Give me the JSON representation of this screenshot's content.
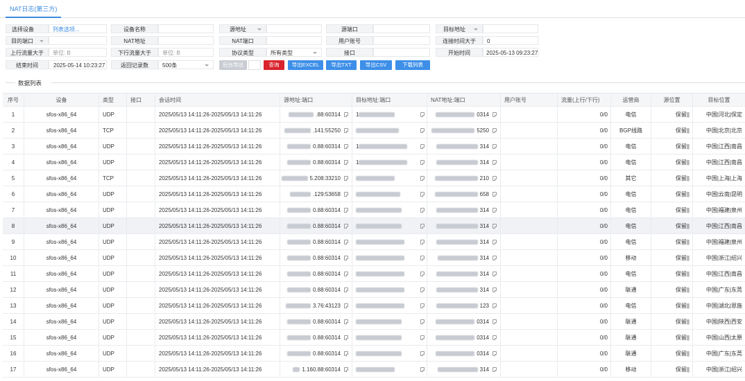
{
  "tab": "NAT日志(第三方)",
  "filters": {
    "device_label": "选择设备",
    "device_link": "列表选项...",
    "device_name_label": "设备名称",
    "src_addr_label": "源地址",
    "src_port_label": "源端口",
    "dst_addr_label": "目标地址",
    "dst_port_label": "目的端口",
    "nat_addr_label": "NAT地址",
    "nat_port_label": "NAT端口",
    "user_label": "用户账号",
    "conn_time_label": "连接时间大于",
    "conn_time_value": "0",
    "up_label": "上行流量大于",
    "up_placeholder": "单位: B",
    "down_label": "下行流量大于",
    "down_placeholder": "单位: B",
    "proto_label": "协议类型",
    "proto_value": "所有类型",
    "iface_label": "接口",
    "start_label": "开始时间",
    "start_value": "2025-05-13 09:23:27",
    "end_label": "结束时间",
    "end_value": "2025-05-14 10:23:27",
    "limit_label": "返回记录数",
    "limit_value": "500条"
  },
  "buttons": {
    "bg_export": "后台导出",
    "query": "查询",
    "excel": "导出EXCEL",
    "txt": "导出TXT",
    "csv": "导出CSV",
    "download": "下载列表"
  },
  "section_title": "数据列表",
  "columns": [
    "序号",
    "设备",
    "类型",
    "接口",
    "会话时间",
    "源地址:端口",
    "目标地址:端口",
    "NAT地址:端口",
    "用户账号",
    "流量(上行/下行)",
    "运营商",
    "源位置",
    "目标位置"
  ],
  "rows": [
    {
      "n": "1",
      "dev": "sfos-x86_64",
      "type": "UDP",
      "iface": "",
      "time": "2025/05/13 14:11:26-2025/05/13 14:11:26",
      "src": ".88:60314",
      "dst": "1",
      "nat": "0314",
      "user": "",
      "flow": "0/0",
      "isp": "电信",
      "srcloc": "保留||",
      "dstloc": "中国|河北|保定"
    },
    {
      "n": "2",
      "dev": "sfos-x86_64",
      "type": "TCP",
      "iface": "",
      "time": "2025/05/13 14:11:26-2025/05/13 14:11:26",
      "src": ".141:55250",
      "dst": "",
      "nat": "5250",
      "user": "",
      "flow": "0/0",
      "isp": "BGP线路",
      "srcloc": "保留||",
      "dstloc": "中国|北京|北京"
    },
    {
      "n": "3",
      "dev": "sfos-x86_64",
      "type": "UDP",
      "iface": "",
      "time": "2025/05/13 14:11:26-2025/05/13 14:11:26",
      "src": "0.88:60314",
      "dst": "1",
      "nat": "314",
      "user": "",
      "flow": "0/0",
      "isp": "电信",
      "srcloc": "保留||",
      "dstloc": "中国|江西|南昌"
    },
    {
      "n": "4",
      "dev": "sfos-x86_64",
      "type": "UDP",
      "iface": "",
      "time": "2025/05/13 14:11:26-2025/05/13 14:11:26",
      "src": "0.88:60314",
      "dst": "1",
      "nat": "314",
      "user": "",
      "flow": "0/0",
      "isp": "电信",
      "srcloc": "保留||",
      "dstloc": "中国|江西|南昌"
    },
    {
      "n": "5",
      "dev": "sfos-x86_64",
      "type": "TCP",
      "iface": "",
      "time": "2025/05/13 14:11:26-2025/05/13 14:11:26",
      "src": "5.208:33210",
      "dst": "",
      "nat": "210",
      "user": "",
      "flow": "0/0",
      "isp": "其它",
      "srcloc": "保留||",
      "dstloc": "中国|上海|上海"
    },
    {
      "n": "6",
      "dev": "sfos-x86_64",
      "type": "UDP",
      "iface": "",
      "time": "2025/05/13 14:11:26-2025/05/13 14:11:26",
      "src": ".129:53658",
      "dst": "",
      "nat": "658",
      "user": "",
      "flow": "0/0",
      "isp": "电信",
      "srcloc": "保留||",
      "dstloc": "中国|云南|昆明"
    },
    {
      "n": "7",
      "dev": "sfos-x86_64",
      "type": "UDP",
      "iface": "",
      "time": "2025/05/13 14:11:26-2025/05/13 14:11:26",
      "src": "0.88:60314",
      "dst": "",
      "nat": "314",
      "user": "",
      "flow": "0/0",
      "isp": "电信",
      "srcloc": "保留||",
      "dstloc": "中国|福建|泉州"
    },
    {
      "n": "8",
      "dev": "sfos-x86_64",
      "type": "UDP",
      "iface": "",
      "time": "2025/05/13 14:11:26-2025/05/13 14:11:26",
      "src": "0.88:60314",
      "dst": "",
      "nat": "314",
      "user": "",
      "flow": "0/0",
      "isp": "电信",
      "srcloc": "保留||",
      "dstloc": "中国|江西|南昌"
    },
    {
      "n": "9",
      "dev": "sfos-x86_64",
      "type": "UDP",
      "iface": "",
      "time": "2025/05/13 14:11:26-2025/05/13 14:11:26",
      "src": "0.88:60314",
      "dst": "",
      "nat": "314",
      "user": "",
      "flow": "0/0",
      "isp": "电信",
      "srcloc": "保留||",
      "dstloc": "中国|福建|泉州"
    },
    {
      "n": "10",
      "dev": "sfos-x86_64",
      "type": "UDP",
      "iface": "",
      "time": "2025/05/13 14:11:26-2025/05/13 14:11:26",
      "src": "0.88:60314",
      "dst": "",
      "nat": "314",
      "user": "",
      "flow": "0/0",
      "isp": "移动",
      "srcloc": "保留||",
      "dstloc": "中国|浙江|绍兴"
    },
    {
      "n": "11",
      "dev": "sfos-x86_64",
      "type": "UDP",
      "iface": "",
      "time": "2025/05/13 14:11:26-2025/05/13 14:11:26",
      "src": "0.88:60314",
      "dst": "",
      "nat": "314",
      "user": "",
      "flow": "0/0",
      "isp": "电信",
      "srcloc": "保留||",
      "dstloc": "中国|江西|南昌"
    },
    {
      "n": "12",
      "dev": "sfos-x86_64",
      "type": "UDP",
      "iface": "",
      "time": "2025/05/13 14:11:26-2025/05/13 14:11:26",
      "src": "0.88:60314",
      "dst": "",
      "nat": "314",
      "user": "",
      "flow": "0/0",
      "isp": "联通",
      "srcloc": "保留||",
      "dstloc": "中国|广东|东莞"
    },
    {
      "n": "13",
      "dev": "sfos-x86_64",
      "type": "UDP",
      "iface": "",
      "time": "2025/05/13 14:11:26-2025/05/13 14:11:26",
      "src": "3.76:43123",
      "dst": "",
      "nat": "123",
      "user": "",
      "flow": "0/0",
      "isp": "电信",
      "srcloc": "保留||",
      "dstloc": "中国|湖北|恩施"
    },
    {
      "n": "14",
      "dev": "sfos-x86_64",
      "type": "UDP",
      "iface": "",
      "time": "2025/05/13 14:11:26-2025/05/13 14:11:26",
      "src": "0.88:60314",
      "dst": "",
      "nat": "0314",
      "user": "",
      "flow": "0/0",
      "isp": "联通",
      "srcloc": "保留||",
      "dstloc": "中国|陕西|西安"
    },
    {
      "n": "15",
      "dev": "sfos-x86_64",
      "type": "UDP",
      "iface": "",
      "time": "2025/05/13 14:11:26-2025/05/13 14:11:26",
      "src": "0.88:60314",
      "dst": "",
      "nat": "0314",
      "user": "",
      "flow": "0/0",
      "isp": "联通",
      "srcloc": "保留||",
      "dstloc": "中国|山西|太原"
    },
    {
      "n": "16",
      "dev": "sfos-x86_64",
      "type": "UDP",
      "iface": "",
      "time": "2025/05/13 14:11:26-2025/05/13 14:11:26",
      "src": "0.88:60314",
      "dst": "",
      "nat": "0314",
      "user": "",
      "flow": "0/0",
      "isp": "联通",
      "srcloc": "保留||",
      "dstloc": "中国|广东|东莞"
    },
    {
      "n": "17",
      "dev": "sfos-x86_64",
      "type": "UDP",
      "iface": "",
      "time": "2025/05/13 14:11:26-2025/05/13 14:11:26",
      "src": "1.160.88:60314",
      "dst": "",
      "nat": "314",
      "user": "",
      "flow": "0/0",
      "isp": "移动",
      "srcloc": "保留||",
      "dstloc": "中国|浙江|绍兴"
    }
  ]
}
